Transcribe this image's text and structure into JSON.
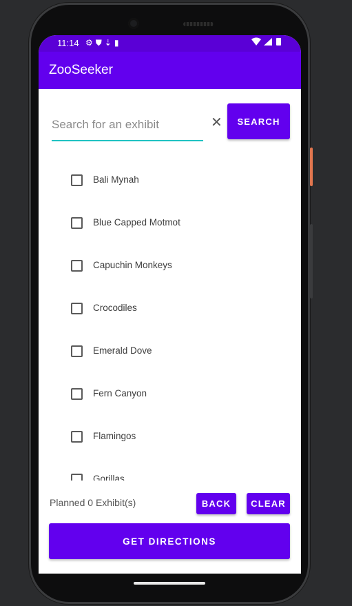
{
  "status_bar": {
    "time": "11:14",
    "left_icons": [
      "gear-icon",
      "shield-icon",
      "download-icon",
      "sd-card-icon"
    ],
    "right_icons": [
      "wifi-icon",
      "signal-icon",
      "battery-icon"
    ]
  },
  "app_bar": {
    "title": "ZooSeeker"
  },
  "search": {
    "placeholder": "Search for an exhibit",
    "value": "",
    "clear_glyph": "✕",
    "button_label": "SEARCH"
  },
  "exhibits": [
    {
      "label": "Bali Mynah",
      "checked": false
    },
    {
      "label": "Blue Capped Motmot",
      "checked": false
    },
    {
      "label": "Capuchin Monkeys",
      "checked": false
    },
    {
      "label": "Crocodiles",
      "checked": false
    },
    {
      "label": "Emerald Dove",
      "checked": false
    },
    {
      "label": "Fern Canyon",
      "checked": false
    },
    {
      "label": "Flamingos",
      "checked": false
    },
    {
      "label": "Gorillas",
      "checked": false
    }
  ],
  "footer": {
    "planned_text": "Planned 0 Exhibit(s)",
    "back_label": "BACK",
    "clear_label": "CLEAR",
    "directions_label": "GET DIRECTIONS"
  },
  "colors": {
    "primary": "#6200ee",
    "status_bar": "#5a00d6",
    "input_underline": "#1fc2c2"
  }
}
